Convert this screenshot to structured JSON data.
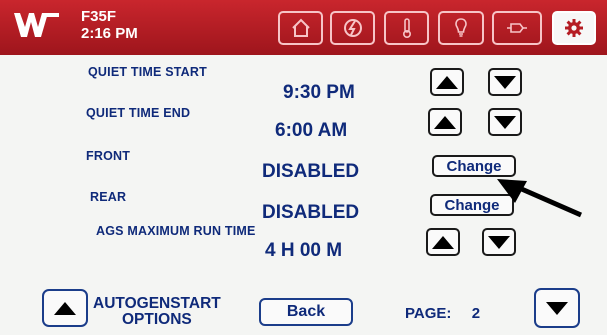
{
  "header": {
    "model": "F35F",
    "time": "2:16 PM",
    "icons": [
      "home-icon",
      "generator-icon",
      "thermometer-icon",
      "light-bulb-icon",
      "plug-icon",
      "gear-icon"
    ]
  },
  "settings": {
    "quiet_start": {
      "label": "QUIET TIME START",
      "value": "9:30 PM"
    },
    "quiet_end": {
      "label": "QUIET TIME END",
      "value": "6:00 AM"
    },
    "front": {
      "label": "FRONT",
      "value": "DISABLED",
      "button": "Change"
    },
    "rear": {
      "label": "REAR",
      "value": "DISABLED",
      "button": "Change"
    },
    "ags_max": {
      "label": "AGS MAXIMUM RUN TIME",
      "value": "4 H 00 M"
    }
  },
  "footer": {
    "options_line1": "AUTOGENSTART",
    "options_line2": "OPTIONS",
    "back": "Back",
    "page_label": "PAGE:",
    "page_number": "2"
  },
  "colors": {
    "header_red": "#b51c23",
    "text_blue": "#0f2a7a",
    "screen_bg": "#f4f5f3"
  }
}
